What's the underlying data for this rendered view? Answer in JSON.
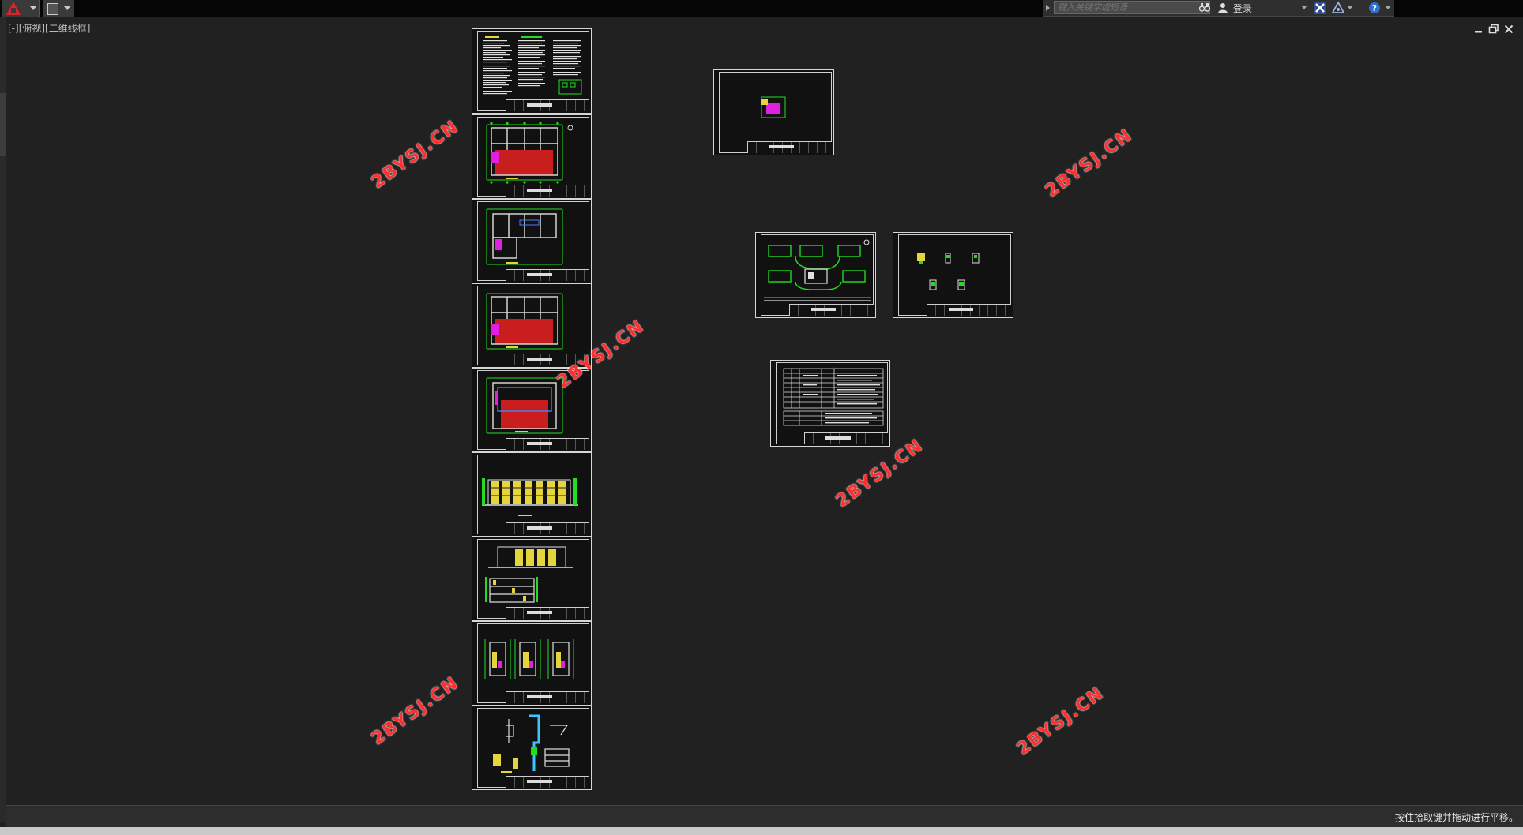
{
  "app": {
    "logo": "autocad-logo-icon"
  },
  "quick_access": {
    "icon": "save-icon"
  },
  "infocenter": {
    "search_placeholder": "键入关键字或短语",
    "login_label": "登录"
  },
  "viewport": {
    "label": "[-][俯视][二维线框]"
  },
  "watermark": {
    "text": "2BYSJ.CN"
  },
  "status": {
    "message": "按住拾取键并拖动进行平移。"
  },
  "colors": {
    "background": "#212121",
    "sheet_border": "#d6d6d6",
    "watermark": "#ff2f2f",
    "drawing_green": "#22dd22",
    "drawing_red": "#c81e1e",
    "drawing_magenta": "#e020e0",
    "drawing_yellow": "#e6d43c"
  }
}
